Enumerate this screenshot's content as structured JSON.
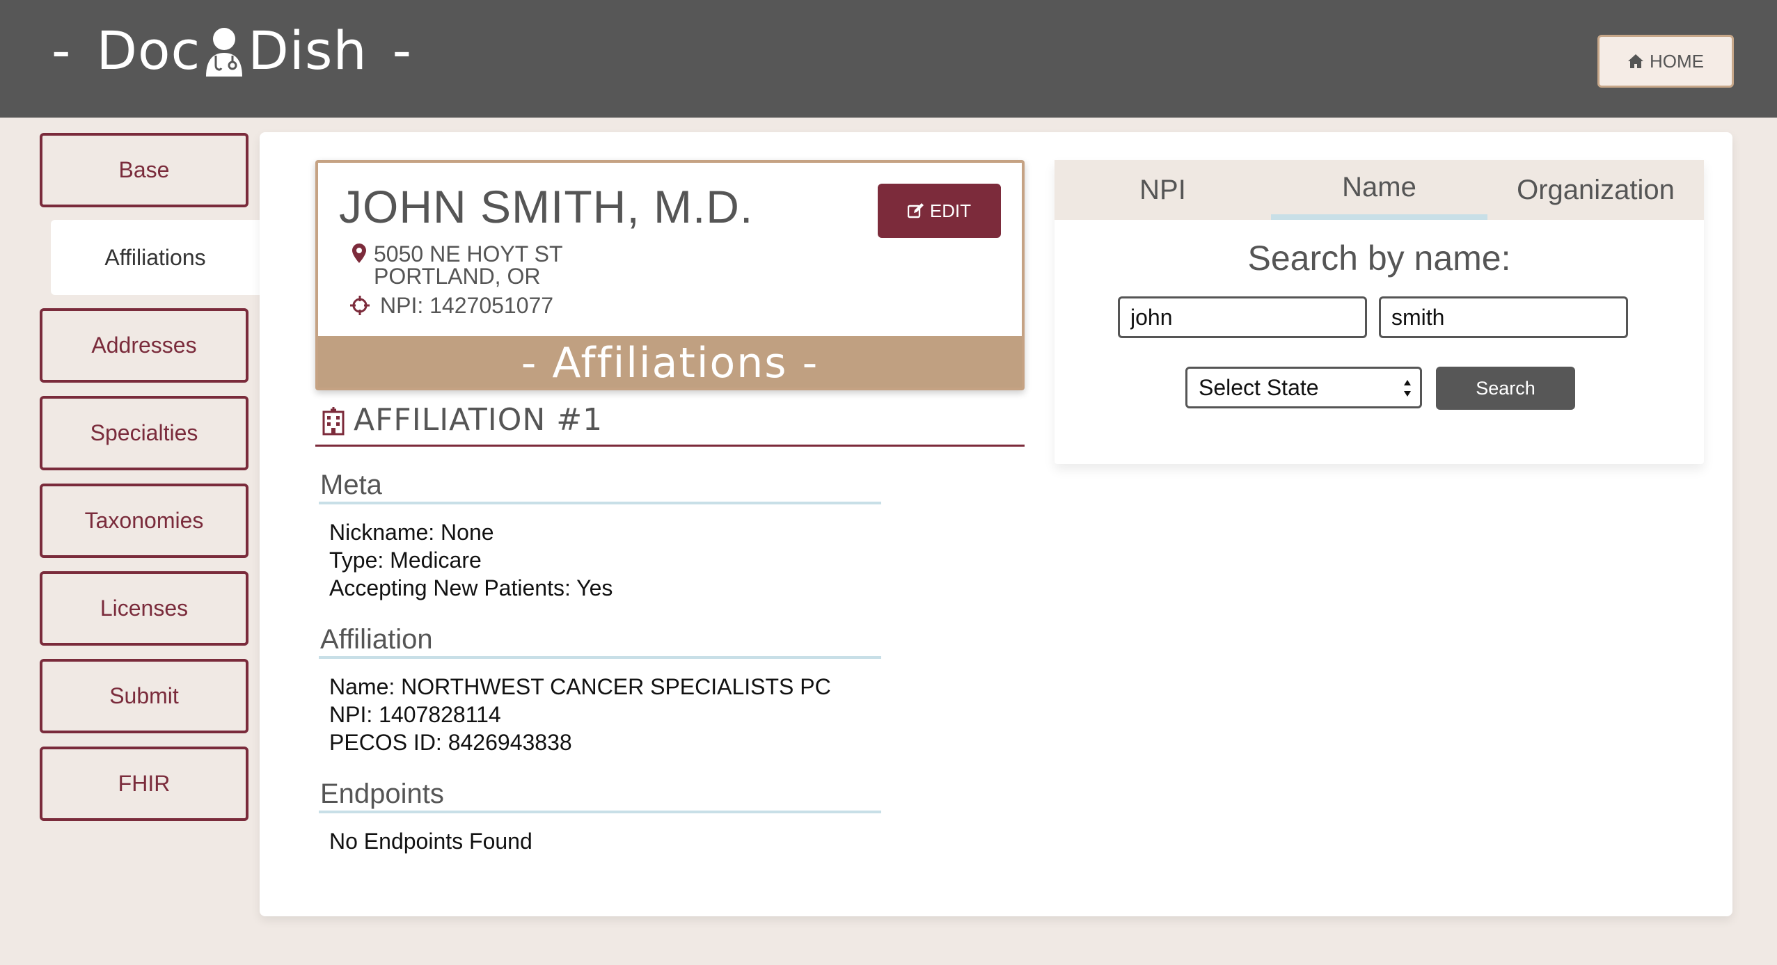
{
  "header": {
    "logo_prefix": "Doc",
    "logo_suffix": "Dish",
    "logo_dash": "-",
    "home_label": "HOME"
  },
  "sidebar": {
    "items": [
      {
        "label": "Base",
        "active": false
      },
      {
        "label": "Affiliations",
        "active": true
      },
      {
        "label": "Addresses",
        "active": false
      },
      {
        "label": "Specialties",
        "active": false
      },
      {
        "label": "Taxonomies",
        "active": false
      },
      {
        "label": "Licenses",
        "active": false
      },
      {
        "label": "Submit",
        "active": false
      },
      {
        "label": "FHIR",
        "active": false
      }
    ]
  },
  "provider": {
    "name": "JOHN SMITH, M.D.",
    "edit_label": "EDIT",
    "address_line1": "5050 NE HOYT ST",
    "address_line2": "PORTLAND, OR",
    "npi": "NPI: 1427051077",
    "banner": "- Affiliations -"
  },
  "affiliation": {
    "heading": "AFFILIATION #1",
    "meta": {
      "title": "Meta",
      "nickname": "Nickname: None",
      "type": "Type: Medicare",
      "accepting": "Accepting New Patients: Yes"
    },
    "details": {
      "title": "Affiliation",
      "name": "Name: NORTHWEST CANCER SPECIALISTS PC",
      "npi": "NPI: 1407828114",
      "pecos": "PECOS ID: 8426943838"
    },
    "endpoints": {
      "title": "Endpoints",
      "text": "No Endpoints Found"
    }
  },
  "search": {
    "tabs": [
      {
        "label": "NPI",
        "active": false
      },
      {
        "label": "Name",
        "active": true
      },
      {
        "label": "Organization",
        "active": false
      }
    ],
    "title": "Search by name:",
    "first_name": "john",
    "last_name": "smith",
    "state_label": "Select State",
    "button_label": "Search"
  },
  "colors": {
    "header_bg": "#575757",
    "brand_maroon": "#7c2b3b",
    "banner_tan": "#c0a081",
    "page_bg": "#f0e9e4",
    "accent_blue": "#c8dfe7"
  }
}
